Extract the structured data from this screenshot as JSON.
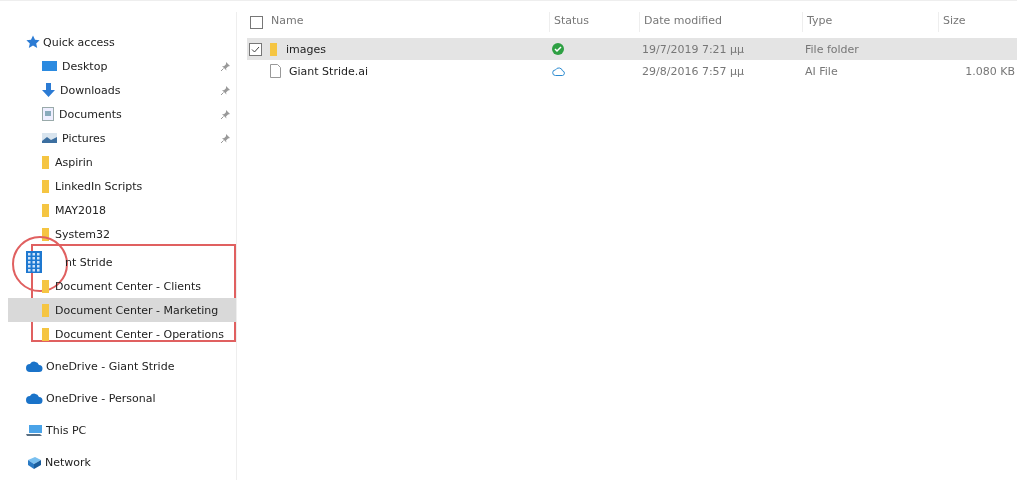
{
  "sidebar": {
    "items": [
      {
        "label": "Quick access",
        "kind": "star",
        "selected": false,
        "children": [
          {
            "label": "Desktop",
            "kind": "desktop",
            "pinned": true,
            "selected": false
          },
          {
            "label": "Downloads",
            "kind": "downloads",
            "pinned": true,
            "selected": false
          },
          {
            "label": "Documents",
            "kind": "documents",
            "pinned": true,
            "selected": false
          },
          {
            "label": "Pictures",
            "kind": "pictures",
            "pinned": true,
            "selected": false
          },
          {
            "label": "Aspirin",
            "kind": "folder",
            "pinned": false,
            "selected": false
          },
          {
            "label": "LinkedIn Scripts",
            "kind": "folder",
            "pinned": false,
            "selected": false
          },
          {
            "label": "MAY2018",
            "kind": "folder",
            "pinned": false,
            "selected": false
          },
          {
            "label": "System32",
            "kind": "folder",
            "pinned": false,
            "selected": false
          }
        ]
      },
      {
        "label": "nt Stride",
        "kind": "building",
        "selected": false,
        "highlighted": true,
        "children": [
          {
            "label": "Document Center - Clients",
            "kind": "folder",
            "pinned": false,
            "selected": false
          },
          {
            "label": "Document Center - Marketing",
            "kind": "folder",
            "pinned": false,
            "selected": true
          },
          {
            "label": "Document Center - Operations",
            "kind": "folder",
            "pinned": false,
            "selected": false
          }
        ]
      },
      {
        "label": "OneDrive - Giant Stride",
        "kind": "cloud",
        "selected": false
      },
      {
        "label": "OneDrive - Personal",
        "kind": "cloud",
        "selected": false
      },
      {
        "label": "This PC",
        "kind": "pc",
        "selected": false
      },
      {
        "label": "Network",
        "kind": "network",
        "selected": false
      }
    ]
  },
  "table": {
    "all_selected": false,
    "columns": [
      "Name",
      "Status",
      "Date modified",
      "Type",
      "Size"
    ],
    "rows": [
      {
        "name": "images",
        "kind": "folder",
        "synced": true,
        "date": "19/7/2019 7:21 μμ",
        "type": "File folder",
        "selected": true
      },
      {
        "name": "Giant Stride.ai",
        "kind": "file",
        "synced": false,
        "date": "29/8/2016 7:57 μμ",
        "type": "AI File",
        "size": "1.080 KB",
        "selected": false
      }
    ]
  }
}
